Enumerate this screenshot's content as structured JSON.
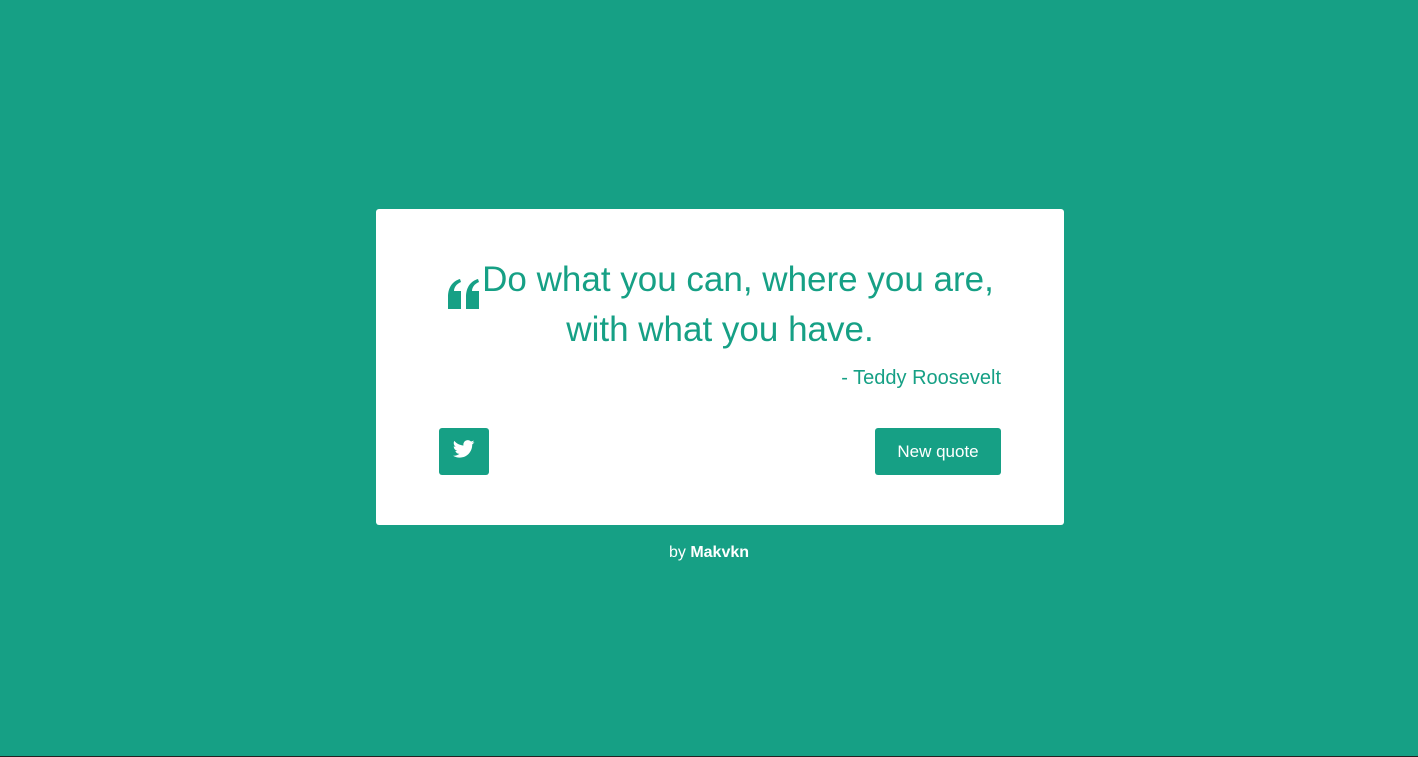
{
  "colors": {
    "background": "#16a085",
    "card": "#ffffff",
    "accent": "#16a085",
    "button_text": "#ffffff"
  },
  "quote": {
    "icon": "quote-left-icon",
    "text": "Do what you can, where you are, with what you have.",
    "author": "- Teddy Roosevelt"
  },
  "actions": {
    "tweet_icon": "twitter-icon",
    "new_quote_label": "New quote"
  },
  "footer": {
    "prefix": "by",
    "author": "Makvkn"
  }
}
